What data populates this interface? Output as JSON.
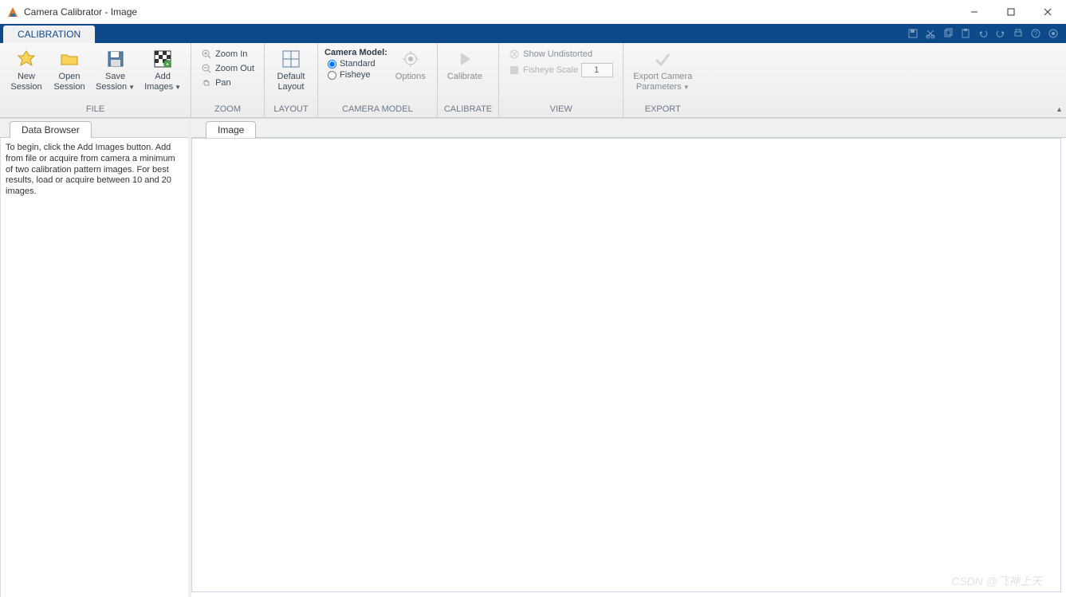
{
  "window": {
    "title": "Camera Calibrator - Image"
  },
  "tabs": {
    "main": "CALIBRATION"
  },
  "ribbon": {
    "file": {
      "label": "FILE",
      "new_session": "New\nSession",
      "open_session": "Open\nSession",
      "save_session": "Save\nSession",
      "add_images": "Add\nImages"
    },
    "zoom": {
      "label": "ZOOM",
      "zoom_in": "Zoom In",
      "zoom_out": "Zoom Out",
      "pan": "Pan"
    },
    "layout": {
      "label": "LAYOUT",
      "default_layout": "Default\nLayout"
    },
    "camera_model": {
      "label": "CAMERA MODEL",
      "title": "Camera Model:",
      "standard": "Standard",
      "fisheye": "Fisheye",
      "options": "Options"
    },
    "calibrate": {
      "label": "CALIBRATE",
      "calibrate": "Calibrate"
    },
    "view": {
      "label": "VIEW",
      "show_undistorted": "Show Undistorted",
      "fisheye_scale": "Fisheye Scale",
      "fisheye_value": "1"
    },
    "export": {
      "label": "EXPORT",
      "export_params": "Export Camera\nParameters"
    }
  },
  "data_browser": {
    "tab": "Data Browser",
    "help_text": "To begin, click the Add Images button. Add from file or acquire from camera a minimum of two calibration pattern images. For best results, load or acquire between 10 and 20 images."
  },
  "image_panel": {
    "tab": "Image"
  },
  "watermark": "CSDN @飞神上天"
}
